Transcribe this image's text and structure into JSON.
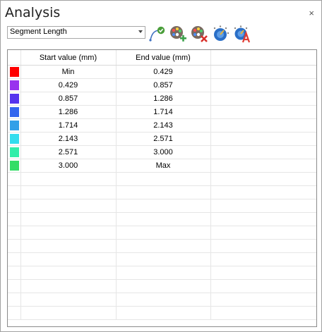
{
  "window": {
    "title": "Analysis",
    "close_glyph": "×"
  },
  "toolbar": {
    "mode_select": {
      "value": "Segment Length"
    },
    "icons": [
      "curve-check-icon",
      "palette-add-icon",
      "palette-delete-icon",
      "gauge-icon",
      "gauge-text-icon"
    ]
  },
  "table": {
    "headers": [
      "Start value (mm)",
      "End value (mm)"
    ],
    "rows": [
      {
        "color": "#ff0000",
        "start": "Min",
        "end": "0.429"
      },
      {
        "color": "#9933ee",
        "start": "0.429",
        "end": "0.857"
      },
      {
        "color": "#5533ee",
        "start": "0.857",
        "end": "1.286"
      },
      {
        "color": "#3366ee",
        "start": "1.286",
        "end": "1.714"
      },
      {
        "color": "#33a0e8",
        "start": "1.714",
        "end": "2.143"
      },
      {
        "color": "#33ddee",
        "start": "2.143",
        "end": "2.571"
      },
      {
        "color": "#33eeaa",
        "start": "2.571",
        "end": "3.000"
      },
      {
        "color": "#33dd66",
        "start": "3.000",
        "end": "Max"
      }
    ],
    "empty_rows": 11
  }
}
